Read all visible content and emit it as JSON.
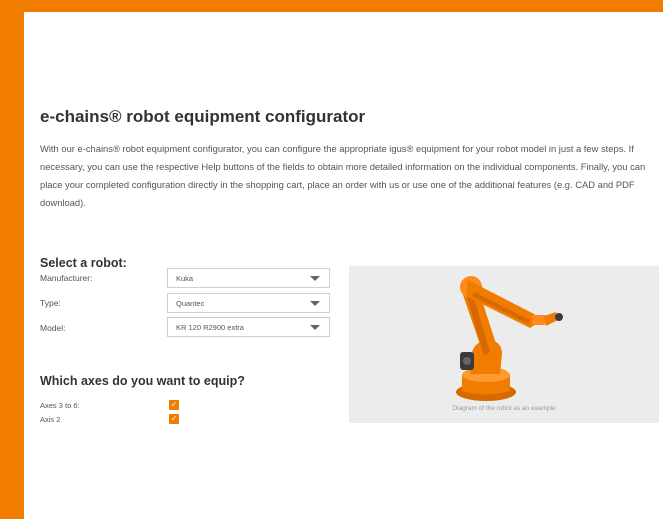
{
  "page": {
    "title": "e-chains® robot equipment configurator",
    "intro": "With our e-chains® robot equipment configurator, you can configure the appropriate igus® equipment for your robot model in just a few steps. If necessary, you can use the respective Help buttons of the fields to obtain more detailed information on the individual components. Finally, you can place your completed configuration directly in the shopping cart, place an order with us or use one of the additional features (e.g. CAD and PDF download)."
  },
  "robot_select": {
    "heading": "Select a robot:",
    "manufacturer": {
      "label": "Manufacturer:",
      "value": "Kuka"
    },
    "type": {
      "label": "Type:",
      "value": "Quantec"
    },
    "model": {
      "label": "Model:",
      "value": "KR 120 R2900 extra"
    }
  },
  "axes": {
    "heading": "Which axes do you want to equip?",
    "options": [
      {
        "label": "Axes 3 to 6:",
        "checked": true
      },
      {
        "label": "Axis 2",
        "checked": true
      }
    ]
  },
  "preview": {
    "caption": "Diagram of the robot as an example",
    "robot_color": "#f07d00"
  },
  "colors": {
    "accent": "#f07d00",
    "background": "#ffffff",
    "image_panel": "#ececec"
  },
  "icons": {
    "dropdown": "chevron-down-icon",
    "checkbox": "checkmark-icon"
  }
}
